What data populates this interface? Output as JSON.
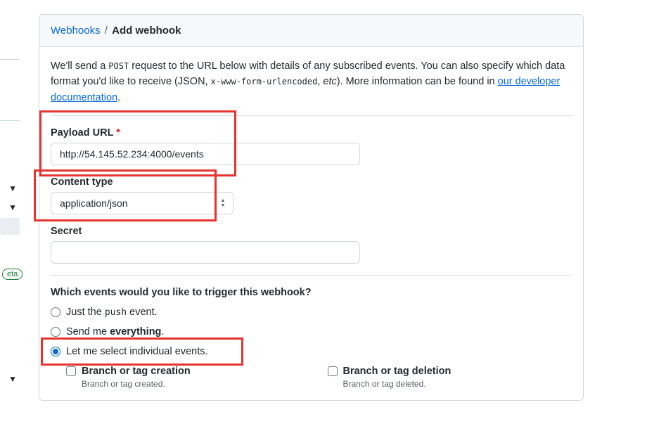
{
  "left": {
    "beta": "eta"
  },
  "breadcrumb": {
    "root": "Webhooks",
    "sep": " / ",
    "current": "Add webhook"
  },
  "intro": {
    "t1": "We'll send a ",
    "post": "POST",
    "t2": " request to the URL below with details of any subscribed events. You can also specify which data format you'd like to receive (JSON, ",
    "enc": "x-www-form-urlencoded",
    "t3": ", ",
    "etc": "etc",
    "t4": "). More information can be found in ",
    "link": "our developer documentation",
    "t5": "."
  },
  "fields": {
    "payload_label": "Payload URL",
    "payload_value": "http://54.145.52.234:4000/events",
    "content_label": "Content type",
    "content_value": "application/json",
    "secret_label": "Secret",
    "secret_value": ""
  },
  "events": {
    "question": "Which events would you like to trigger this webhook?",
    "r1a": "Just the ",
    "r1b": "push",
    "r1c": " event.",
    "r2a": "Send me ",
    "r2b": "everything",
    "r2c": ".",
    "r3": "Let me select individual events.",
    "opt1": {
      "title": "Branch or tag creation",
      "desc": "Branch or tag created."
    },
    "opt2": {
      "title": "Branch or tag deletion",
      "desc": "Branch or tag deleted."
    }
  }
}
